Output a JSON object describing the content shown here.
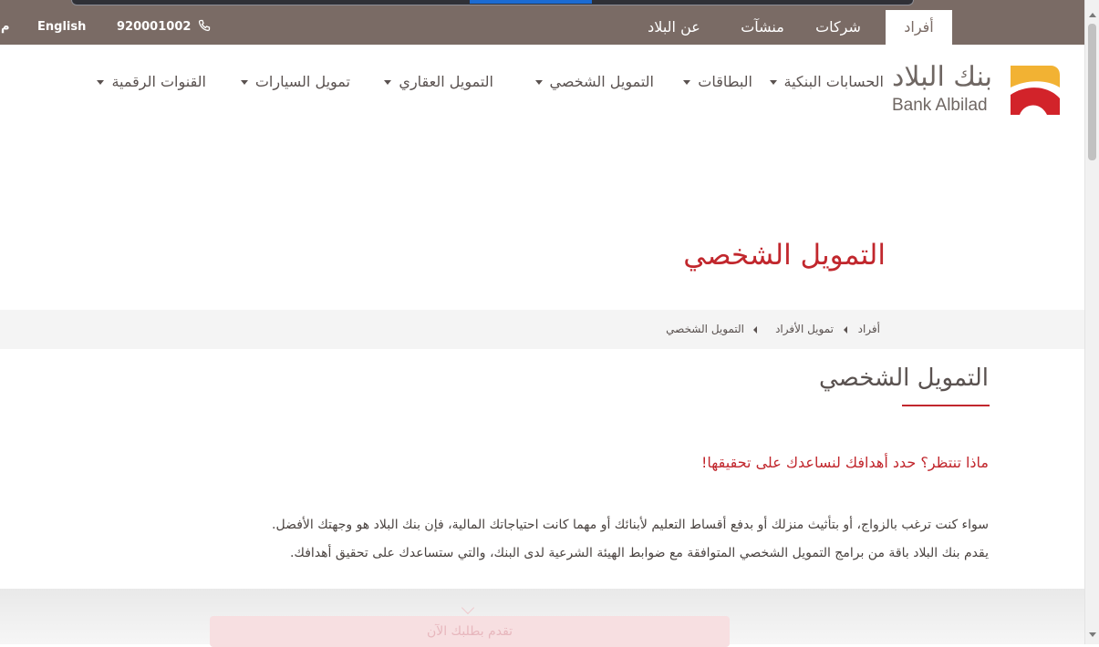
{
  "topbar": {
    "tabs": [
      "أفراد",
      "شركات",
      "منشآت",
      "عن البلاد"
    ],
    "phone": "920001002",
    "language": "English",
    "cut_text": "م"
  },
  "logo": {
    "arabic": "بنك البلاد",
    "english": "Bank Albilad"
  },
  "nav": {
    "items": [
      "الحسابات البنكية",
      "البطاقات",
      "التمويل الشخصي",
      "التمويل العقاري",
      "تمويل السيارات",
      "القنوات الرقمية"
    ]
  },
  "hero": {
    "title": "التمويل الشخصي"
  },
  "breadcrumb": [
    "أفراد",
    "تمويل الأفراد",
    "التمويل الشخصي"
  ],
  "content": {
    "title": "التمويل الشخصي",
    "subheading": "ماذا تنتظر؟ حدد أهدافك لنساعدك على تحقيقها!",
    "paragraph1": "سواء كنت ترغب بالزواج، أو بتأثيث منزلك أو بدفع أقساط التعليم لأبنائك أو مهما كانت احتياجاتك المالية، فإن بنك البلاد هو وجهتك الأفضل.",
    "paragraph2": "يقدم بنك البلاد باقة من برامج التمويل الشخصي المتوافقة مع ضوابط الهيئة الشرعية لدى البنك، والتي ستساعدك على تحقيق أهدافك."
  },
  "cta": {
    "label": "تقدم بطلبك الآن"
  },
  "colors": {
    "brand_red": "#c1272d",
    "topbar": "#7a6b65",
    "logo_yellow": "#f2b233",
    "text": "#5a5250"
  },
  "icons": {
    "phone": "phone-icon",
    "dropdown": "caret-down-icon",
    "breadcrumb_separator": "triangle-left-icon",
    "scroll_hint": "chevron-down-icon"
  }
}
